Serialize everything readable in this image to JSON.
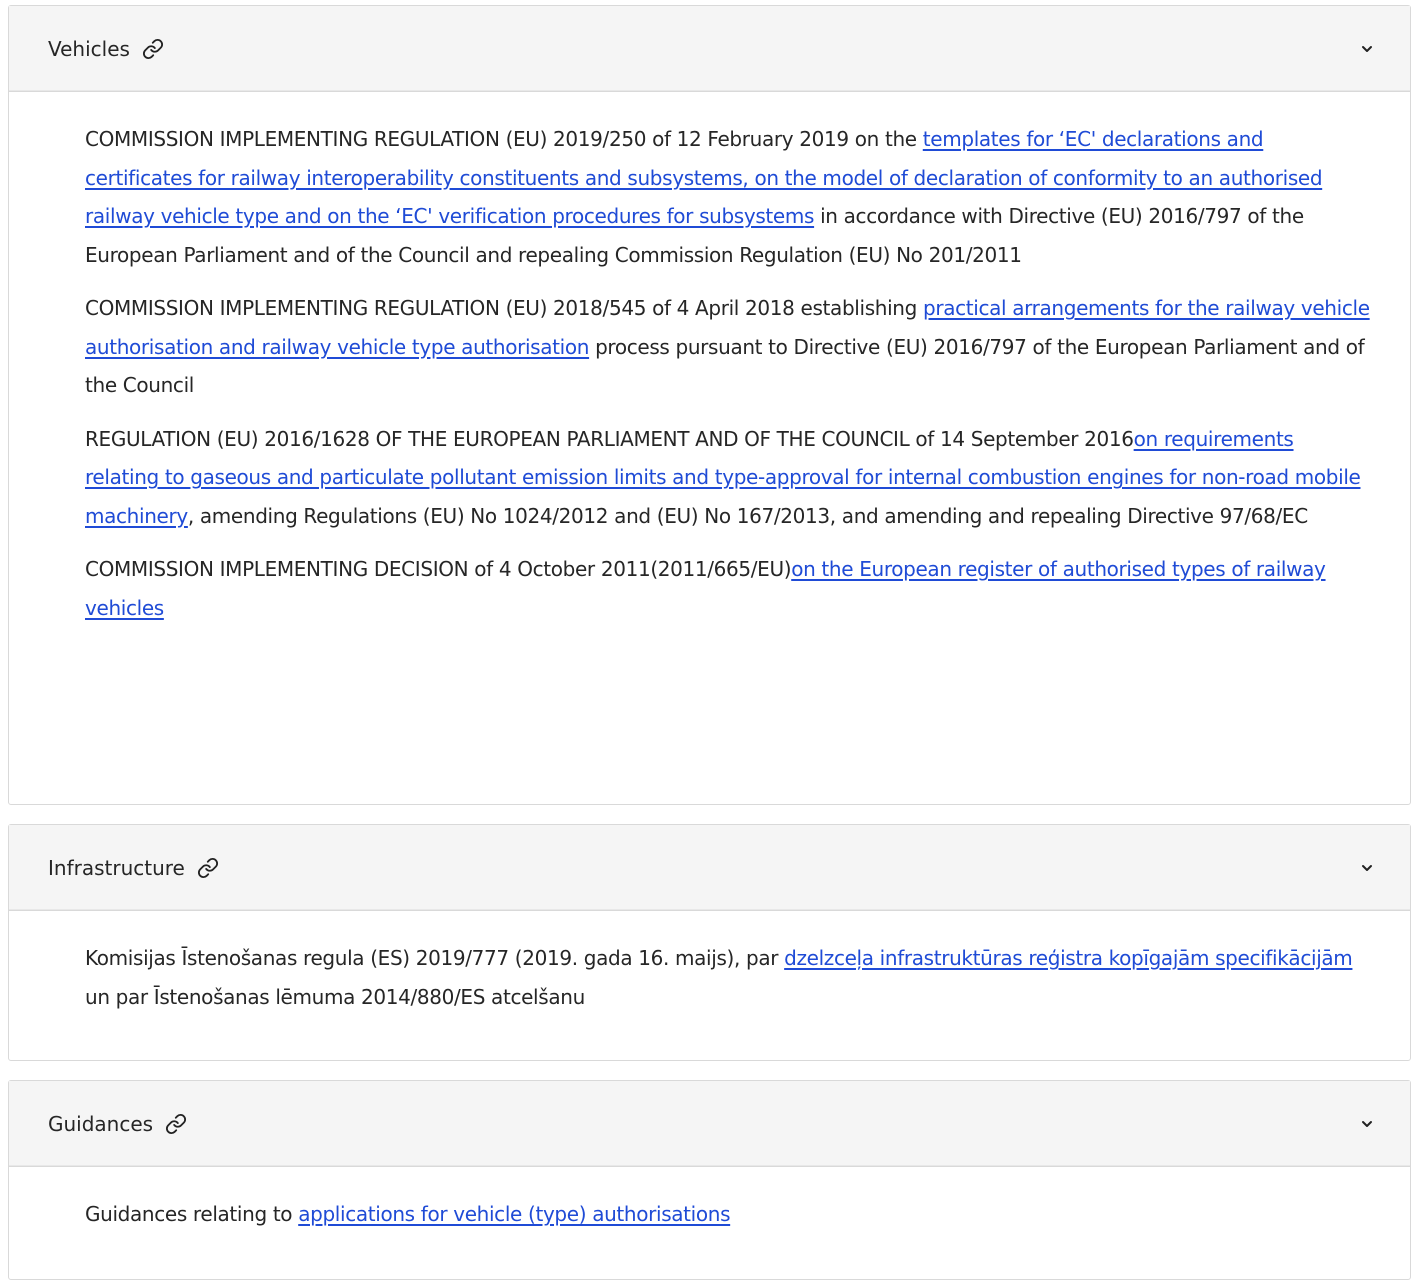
{
  "sections": [
    {
      "title": "Vehicles",
      "paragraphs": [
        {
          "before": "COMMISSION IMPLEMENTING REGULATION (EU) 2019/250 of 12 February 2019 on the ",
          "link": "templates for ‘EC' declarations and certificates for railway interoperability constituents and subsystems, on the model of declaration of conformity to an authorised railway vehicle type and on the ‘EC' verification procedures for subsystems",
          "after": " in accordance with Directive (EU) 2016/797 of the European Parliament and of the Council and repealing Commission Regulation (EU) No 201/2011"
        },
        {
          "before": " COMMISSION IMPLEMENTING REGULATION (EU) 2018/545 of 4 April 2018 establishing ",
          "link": "practical arrangements for the railway vehicle authorisation and railway vehicle type authorisation",
          "after": " process pursuant to Directive (EU) 2016/797 of the European Parliament and of the Council"
        },
        {
          "before": " REGULATION (EU) 2016/1628 OF THE EUROPEAN PARLIAMENT AND OF THE COUNCIL of 14 September 2016",
          "link": "on requirements relating to gaseous and particulate pollutant emission limits and type-approval for internal combustion engines for non-road mobile machinery",
          "after": ", amending Regulations (EU) No 1024/2012 and (EU) No 167/2013, and amending and repealing Directive 97/68/EC"
        },
        {
          "before": "COMMISSION IMPLEMENTING DECISION of 4 October 2011(2011/665/EU)",
          "link": "on the European register of authorised types of railway vehicles ",
          "after": ""
        }
      ]
    },
    {
      "title": "Infrastructure",
      "paragraphs": [
        {
          "before": "Komisijas Īstenošanas regula (ES) 2019/777 (2019. gada 16. maijs), par ",
          "link": "dzelzceļa infrastruktūras reģistra kopīgajām specifikācijām ",
          "after": "un par Īstenošanas lēmuma 2014/880/ES atcelšanu"
        }
      ]
    },
    {
      "title": "Guidances",
      "paragraphs": [
        {
          "before": "Guidances relating to ",
          "link": "applications for vehicle (type) authorisations",
          "after": ""
        }
      ]
    }
  ],
  "icons": {
    "anchor": "link-icon",
    "toggle": "chevron-down-icon"
  },
  "colors": {
    "link": "#1f4bd6",
    "header_bg": "#f5f5f5",
    "border": "#d9d9d9"
  }
}
